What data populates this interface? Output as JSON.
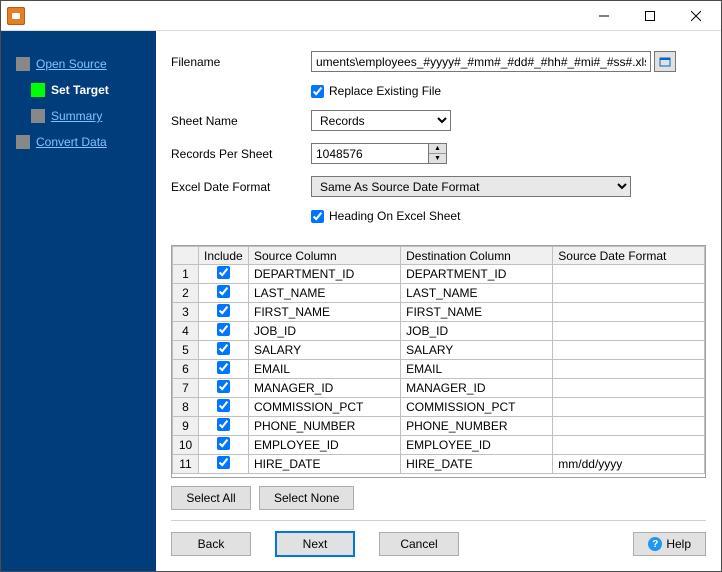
{
  "window": {
    "title": ""
  },
  "nav": {
    "open_source": "Open Source",
    "set_target": "Set Target",
    "summary": "Summary",
    "convert_data": "Convert Data"
  },
  "form": {
    "filename_label": "Filename",
    "filename_value": "uments\\employees_#yyyy#_#mm#_#dd#_#hh#_#mi#_#ss#.xlsx",
    "replace_existing": "Replace Existing File",
    "sheet_name_label": "Sheet Name",
    "sheet_name_value": "Records",
    "records_per_sheet_label": "Records Per Sheet",
    "records_per_sheet_value": "1048576",
    "date_format_label": "Excel Date Format",
    "date_format_value": "Same As Source Date Format",
    "heading_on_sheet": "Heading On Excel Sheet"
  },
  "table": {
    "headers": {
      "include": "Include",
      "source": "Source Column",
      "dest": "Destination Column",
      "datefmt": "Source Date Format"
    },
    "rows": [
      {
        "n": "1",
        "inc": true,
        "src": "DEPARTMENT_ID",
        "dst": "DEPARTMENT_ID",
        "fmt": ""
      },
      {
        "n": "2",
        "inc": true,
        "src": "LAST_NAME",
        "dst": "LAST_NAME",
        "fmt": ""
      },
      {
        "n": "3",
        "inc": true,
        "src": "FIRST_NAME",
        "dst": "FIRST_NAME",
        "fmt": ""
      },
      {
        "n": "4",
        "inc": true,
        "src": "JOB_ID",
        "dst": "JOB_ID",
        "fmt": ""
      },
      {
        "n": "5",
        "inc": true,
        "src": "SALARY",
        "dst": "SALARY",
        "fmt": ""
      },
      {
        "n": "6",
        "inc": true,
        "src": "EMAIL",
        "dst": "EMAIL",
        "fmt": ""
      },
      {
        "n": "7",
        "inc": true,
        "src": "MANAGER_ID",
        "dst": "MANAGER_ID",
        "fmt": ""
      },
      {
        "n": "8",
        "inc": true,
        "src": "COMMISSION_PCT",
        "dst": "COMMISSION_PCT",
        "fmt": ""
      },
      {
        "n": "9",
        "inc": true,
        "src": "PHONE_NUMBER",
        "dst": "PHONE_NUMBER",
        "fmt": ""
      },
      {
        "n": "10",
        "inc": true,
        "src": "EMPLOYEE_ID",
        "dst": "EMPLOYEE_ID",
        "fmt": ""
      },
      {
        "n": "11",
        "inc": true,
        "src": "HIRE_DATE",
        "dst": "HIRE_DATE",
        "fmt": "mm/dd/yyyy"
      }
    ]
  },
  "buttons": {
    "select_all": "Select All",
    "select_none": "Select None",
    "back": "Back",
    "next": "Next",
    "cancel": "Cancel",
    "help": "Help"
  }
}
